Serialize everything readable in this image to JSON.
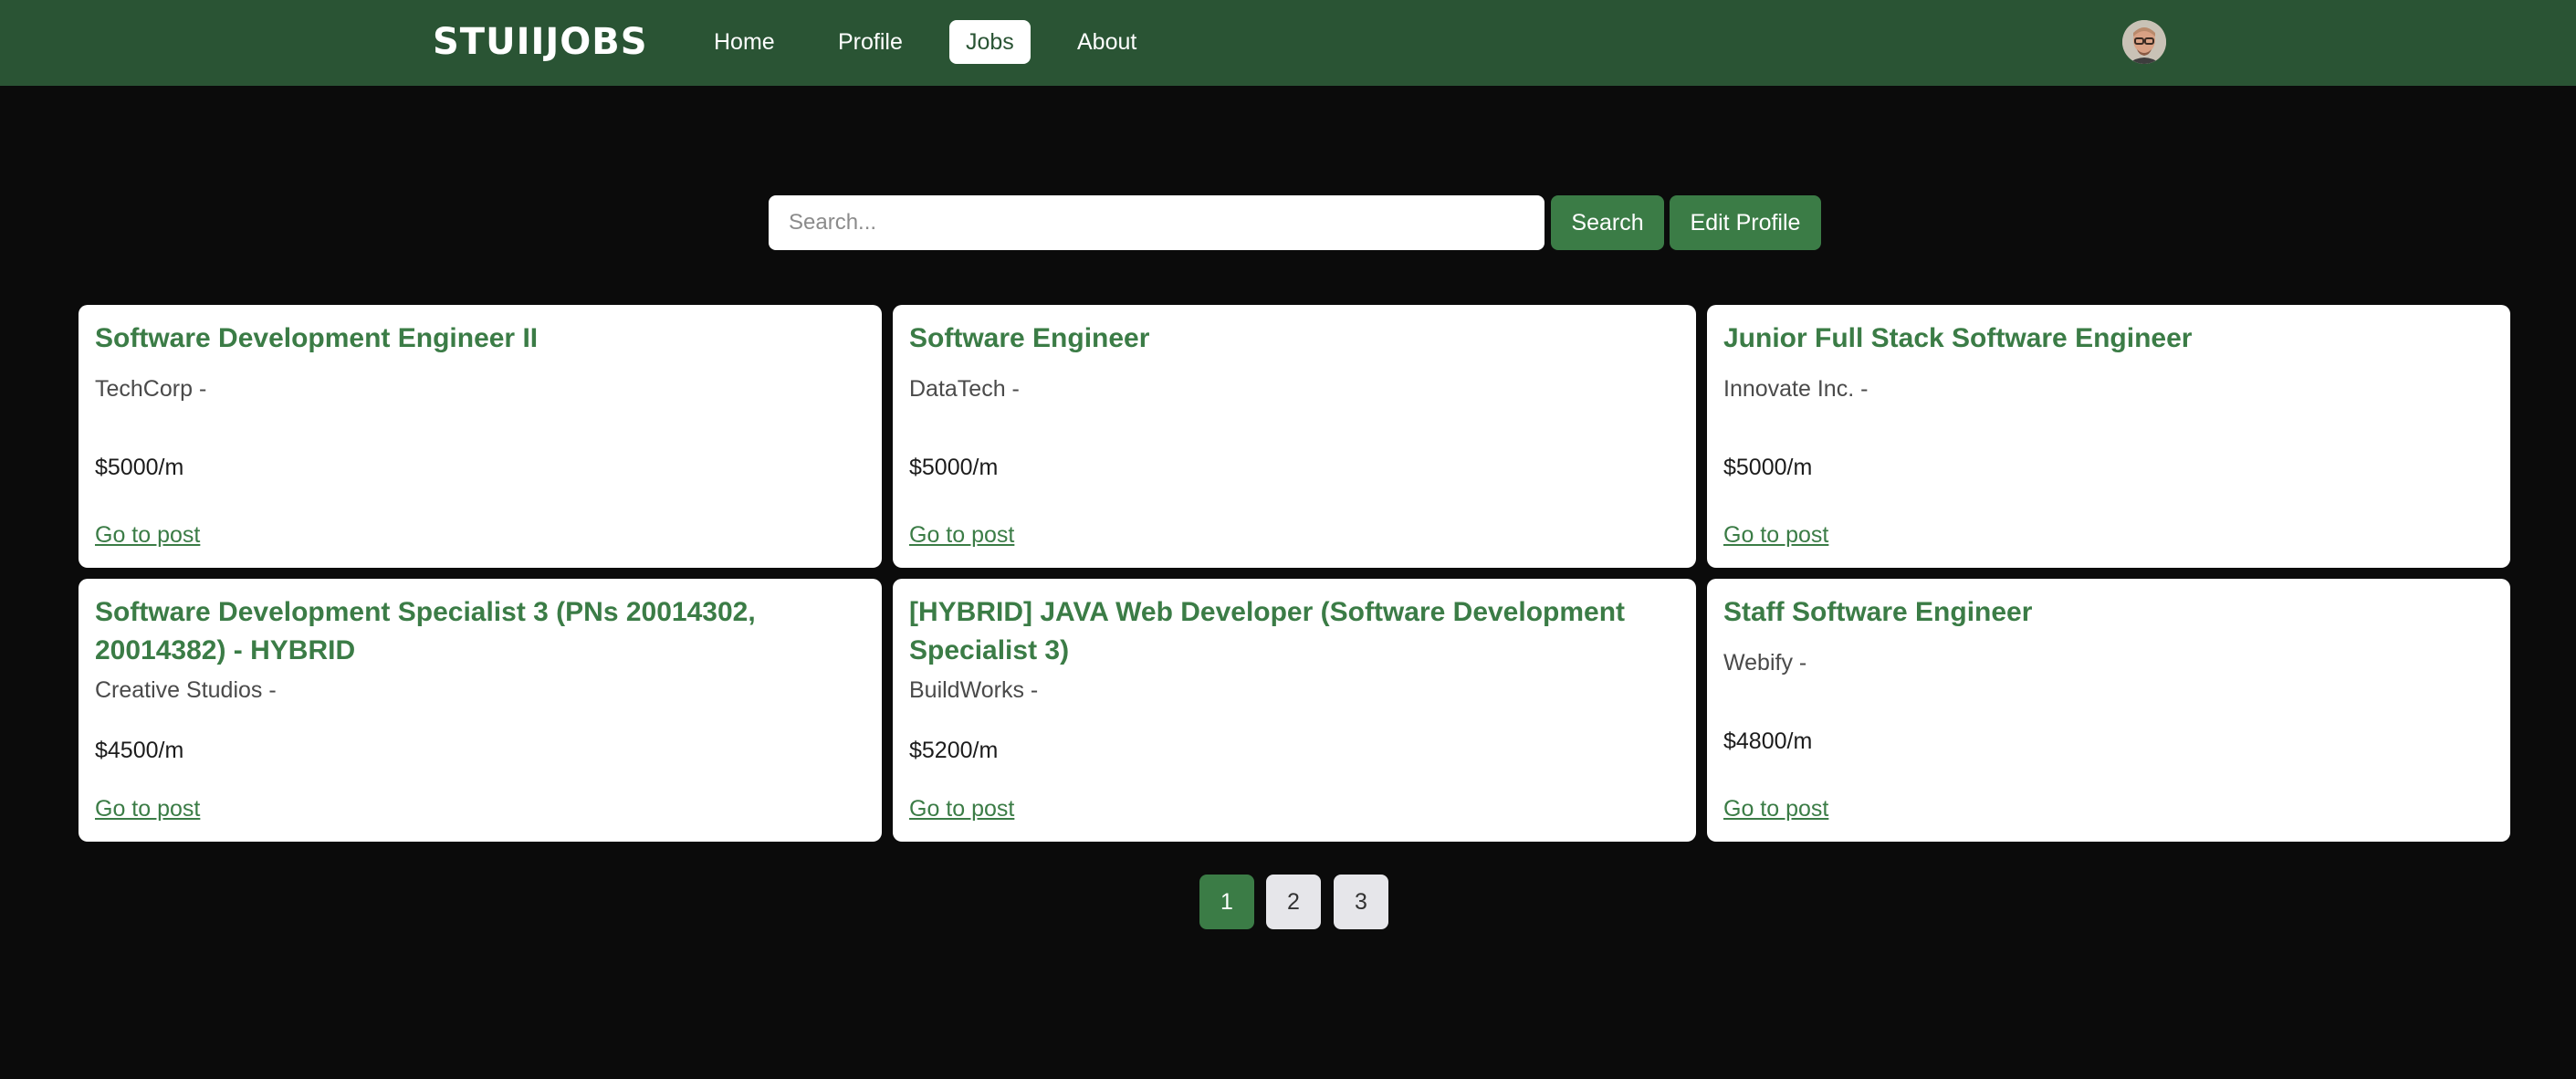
{
  "navbar": {
    "logo": "STUIIJOBS",
    "links": [
      {
        "label": "Home",
        "active": false
      },
      {
        "label": "Profile",
        "active": false
      },
      {
        "label": "Jobs",
        "active": true
      },
      {
        "label": "About",
        "active": false
      }
    ],
    "colors": {
      "background": "#2a5434",
      "active_bg": "#ffffff"
    }
  },
  "search": {
    "placeholder": "Search...",
    "value": "",
    "search_button": "Search",
    "edit_profile_button": "Edit Profile"
  },
  "jobs": [
    {
      "title": "Software Development Engineer II",
      "company": "TechCorp -",
      "salary": "$5000/m",
      "link": "Go to post"
    },
    {
      "title": "Software Engineer",
      "company": "DataTech -",
      "salary": "$5000/m",
      "link": "Go to post"
    },
    {
      "title": "Junior Full Stack Software Engineer",
      "company": "Innovate Inc. -",
      "salary": "$5000/m",
      "link": "Go to post"
    },
    {
      "title": "Software Development Specialist 3 (PNs 20014302, 20014382) - HYBRID",
      "company": "Creative Studios -",
      "salary": "$4500/m",
      "link": "Go to post"
    },
    {
      "title": "[HYBRID] JAVA Web Developer (Software Development Specialist 3)",
      "company": "BuildWorks -",
      "salary": "$5200/m",
      "link": "Go to post"
    },
    {
      "title": "Staff Software Engineer",
      "company": "Webify -",
      "salary": "$4800/m",
      "link": "Go to post"
    }
  ],
  "pagination": {
    "pages": [
      "1",
      "2",
      "3"
    ],
    "current": "1"
  },
  "colors": {
    "page_background": "#0b0b0b",
    "accent": "#3b7c46",
    "card_background": "#ffffff"
  }
}
